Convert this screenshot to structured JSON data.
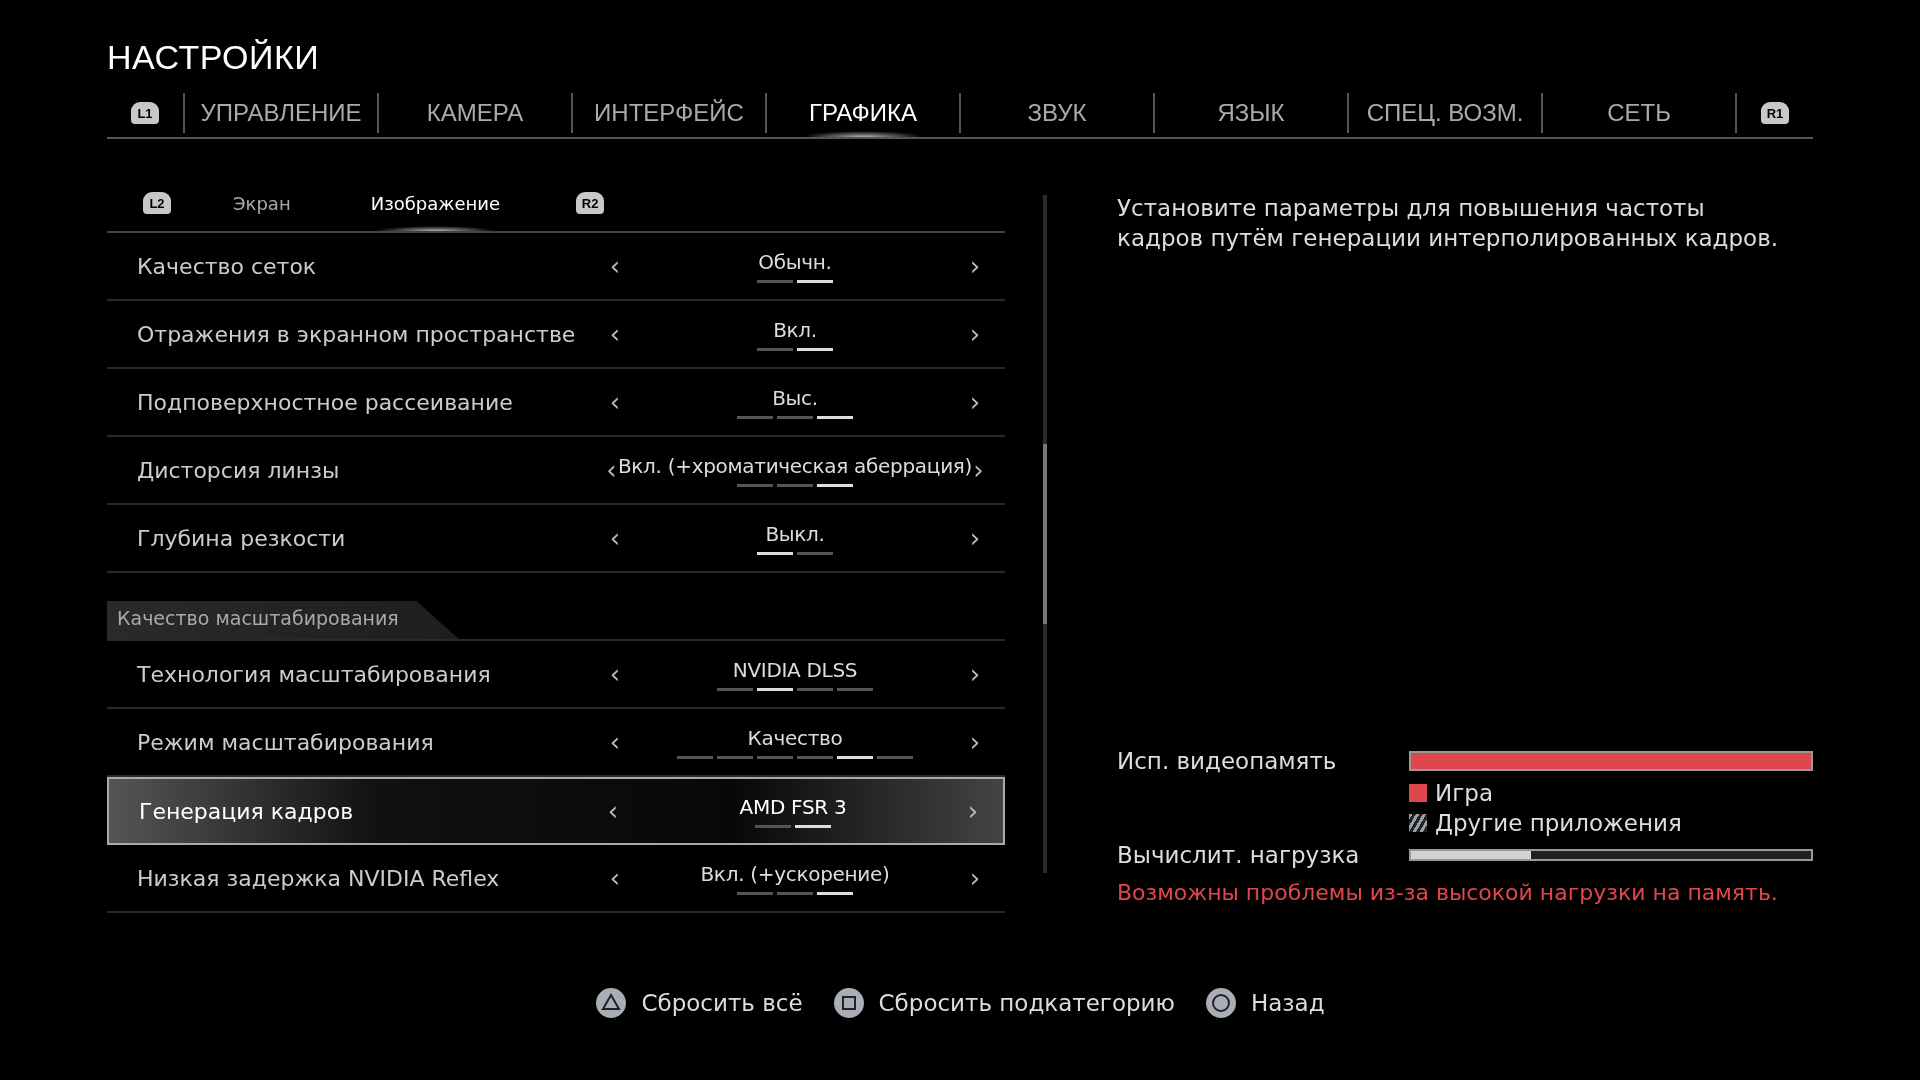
{
  "title": "НАСТРОЙКИ",
  "tabs_prev_button": "L1",
  "tabs_next_button": "R1",
  "tabs": [
    {
      "label": "УПРАВЛЕНИЕ",
      "selected": false
    },
    {
      "label": "КАМЕРА",
      "selected": false
    },
    {
      "label": "ИНТЕРФЕЙС",
      "selected": false
    },
    {
      "label": "ГРАФИКА",
      "selected": true
    },
    {
      "label": "ЗВУК",
      "selected": false
    },
    {
      "label": "ЯЗЫК",
      "selected": false
    },
    {
      "label": "СПЕЦ. ВОЗМ.",
      "selected": false
    },
    {
      "label": "СЕТЬ",
      "selected": false
    }
  ],
  "subtabs_prev_button": "L2",
  "subtabs_next_button": "R2",
  "subtabs": [
    {
      "label": "Экран",
      "selected": false
    },
    {
      "label": "Изображение",
      "selected": true
    }
  ],
  "settings": [
    {
      "kind": "option",
      "label": "Качество сеток",
      "value": "Обычн.",
      "selected": false,
      "steps": [
        {
          "selected": false
        },
        {
          "selected": true
        }
      ]
    },
    {
      "kind": "option",
      "label": "Отражения в экранном пространстве",
      "value": "Вкл.",
      "selected": false,
      "steps": [
        {
          "selected": false
        },
        {
          "selected": true
        }
      ]
    },
    {
      "kind": "option",
      "label": "Подповерхностное рассеивание",
      "value": "Выс.",
      "selected": false,
      "steps": [
        {
          "selected": false
        },
        {
          "selected": false
        },
        {
          "selected": true
        }
      ]
    },
    {
      "kind": "option",
      "label": "Дисторсия линзы",
      "value": "Вкл. (+хроматическая аберрация)",
      "selected": false,
      "steps": [
        {
          "selected": false
        },
        {
          "selected": false
        },
        {
          "selected": true
        }
      ]
    },
    {
      "kind": "option",
      "label": "Глубина резкости",
      "value": "Выкл.",
      "selected": false,
      "steps": [
        {
          "selected": true
        },
        {
          "selected": false
        }
      ]
    },
    {
      "kind": "header",
      "label": "Качество масштабирования"
    },
    {
      "kind": "option",
      "label": "Технология масштабирования",
      "value": "NVIDIA DLSS",
      "selected": false,
      "steps": [
        {
          "selected": false
        },
        {
          "selected": true
        },
        {
          "selected": false
        },
        {
          "selected": false
        }
      ]
    },
    {
      "kind": "option",
      "label": "Режим масштабирования",
      "value": "Качество",
      "selected": false,
      "steps": [
        {
          "selected": false
        },
        {
          "selected": false
        },
        {
          "selected": false
        },
        {
          "selected": false
        },
        {
          "selected": true
        },
        {
          "selected": false
        }
      ]
    },
    {
      "kind": "option",
      "label": "Генерация кадров",
      "value": "AMD FSR 3",
      "selected": true,
      "steps": [
        {
          "selected": false
        },
        {
          "selected": true
        }
      ]
    },
    {
      "kind": "option",
      "label": "Низкая задержка NVIDIA Reflex",
      "value": "Вкл. (+ускорение)",
      "selected": false,
      "steps": [
        {
          "selected": false
        },
        {
          "selected": false
        },
        {
          "selected": true
        }
      ]
    }
  ],
  "arrow_left": "‹",
  "arrow_right": "›",
  "description": "Установите параметры для повышения частоты кадров путём генерации интерполированных кадров.",
  "vram": {
    "label": "Исп. видеопамять",
    "level": 1.0
  },
  "legend": [
    {
      "kind": "solid",
      "label": "Игра",
      "color": "#e0474c"
    },
    {
      "kind": "hatched",
      "label": "Другие приложения",
      "color": "#9a9ea6"
    }
  ],
  "compute": {
    "label": "Вычислит. нагрузка",
    "level": 0.3
  },
  "warning": "Возможны проблемы из-за высокой нагрузки на память.",
  "footer": [
    {
      "kind": "triangle",
      "label": "Сбросить всё"
    },
    {
      "kind": "square",
      "label": "Сбросить подкатегорию"
    },
    {
      "kind": "circle",
      "label": "Назад"
    }
  ]
}
